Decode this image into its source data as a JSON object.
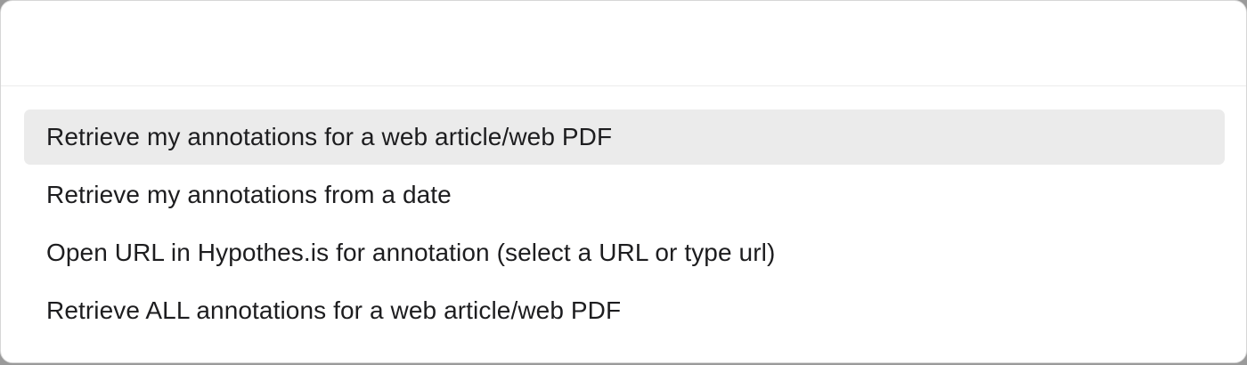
{
  "search": {
    "value": "",
    "placeholder": ""
  },
  "results": [
    {
      "label": "Retrieve my annotations for a web article/web PDF",
      "selected": true
    },
    {
      "label": "Retrieve my annotations from a date",
      "selected": false
    },
    {
      "label": "Open URL in Hypothes.is for annotation (select a URL or type url)",
      "selected": false
    },
    {
      "label": "Retrieve ALL annotations for a web article/web PDF",
      "selected": false
    }
  ],
  "colors": {
    "selected_background": "#ebebeb",
    "text": "#1d1d1f"
  }
}
